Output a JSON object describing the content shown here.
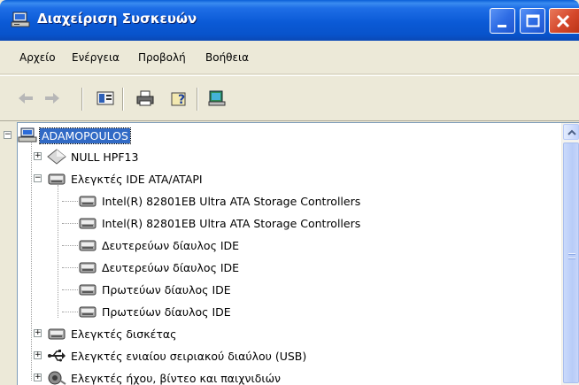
{
  "window": {
    "title": "Διαχείριση Συσκευών",
    "icon": "device-manager-icon"
  },
  "menu": [
    {
      "label": "Αρχείο",
      "key": "Α"
    },
    {
      "label": "Ενέργεια",
      "key": "Ε"
    },
    {
      "label": "Προβολή",
      "key": "Π"
    },
    {
      "label": "Βοήθεια",
      "key": "Β"
    }
  ],
  "toolbar": {
    "icons": [
      "back-arrow-icon",
      "forward-arrow-icon",
      "properties-icon",
      "print-icon",
      "help-icon",
      "scan-hardware-icon"
    ]
  },
  "tree": [
    {
      "label": "ADAMOPOULOS",
      "icon": "computer-icon",
      "level": 0,
      "expander": "−",
      "selected": true
    },
    {
      "label": "NULL HPF13",
      "icon": "diamond-device-icon",
      "level": 1,
      "expander": "+"
    },
    {
      "label": "Ελεγκτές IDE ATA/ATAPI",
      "icon": "ide-controller-icon",
      "level": 1,
      "expander": "−"
    },
    {
      "label": "Intel(R) 82801EB Ultra ATA Storage Controllers",
      "icon": "ide-controller-icon",
      "level": 2
    },
    {
      "label": "Intel(R) 82801EB Ultra ATA Storage Controllers",
      "icon": "ide-controller-icon",
      "level": 2
    },
    {
      "label": "Δευτερεύων δίαυλος IDE",
      "icon": "ide-controller-icon",
      "level": 2
    },
    {
      "label": "Δευτερεύων δίαυλος IDE",
      "icon": "ide-controller-icon",
      "level": 2
    },
    {
      "label": "Πρωτεύων δίαυλος IDE",
      "icon": "ide-controller-icon",
      "level": 2
    },
    {
      "label": "Πρωτεύων δίαυλος IDE",
      "icon": "ide-controller-icon",
      "level": 2
    },
    {
      "label": "Ελεγκτές δισκέτας",
      "icon": "floppy-controller-icon",
      "level": 1,
      "expander": "+"
    },
    {
      "label": "Ελεγκτές ενιαίου σειριακού διαύλου (USB)",
      "icon": "usb-icon",
      "level": 1,
      "expander": "+"
    },
    {
      "label": "Ελεγκτές ήχου, βίντεο και παιχνιδιών",
      "icon": "sound-icon",
      "level": 1,
      "expander": "+"
    }
  ],
  "colors": {
    "titlebar": "#0853CB",
    "selection": "#316AC5",
    "chrome": "#ECE9D8"
  }
}
